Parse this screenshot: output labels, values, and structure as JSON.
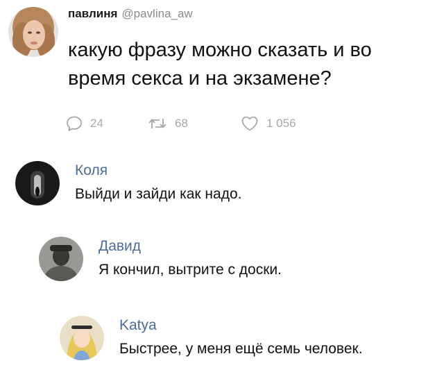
{
  "tweet": {
    "author_name": "павлиня",
    "author_handle": "@pavlina_aw",
    "text": "какую фразу можно сказать и во время секса и на экзамене?",
    "reply_icon": "speech-bubble-icon",
    "retweet_icon": "retweet-icon",
    "like_icon": "heart-icon",
    "replies": "24",
    "retweets": "68",
    "likes": "1 056"
  },
  "comments": [
    {
      "author": "Коля",
      "text": "Выйди и зайди как надо."
    },
    {
      "author": "Давид",
      "text": "Я кончил, вытрите с доски."
    },
    {
      "author": "Katya",
      "text": "Быстрее, у меня ещё семь человек."
    }
  ],
  "colors": {
    "comment_author": "#4a6e9a",
    "action_gray": "#a8a8a8",
    "handle_gray": "#8a8a8a"
  }
}
